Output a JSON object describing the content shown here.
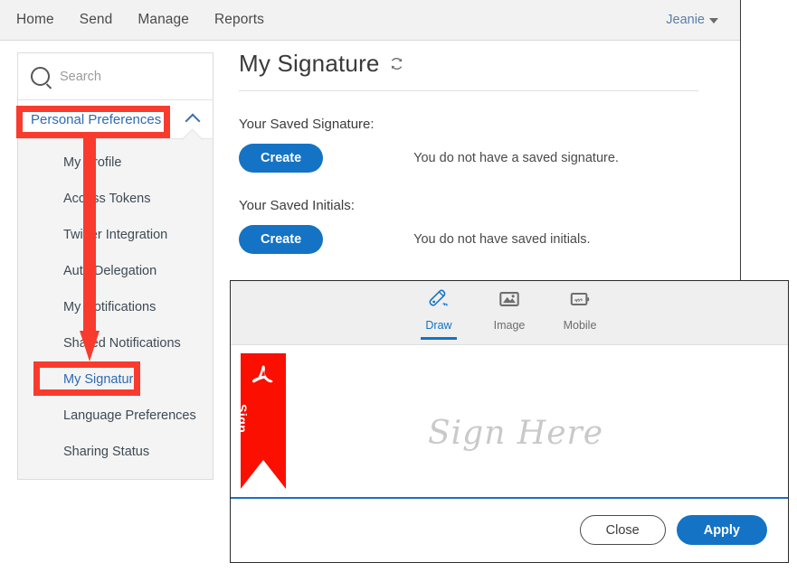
{
  "topnav": {
    "links": [
      {
        "label": "Home"
      },
      {
        "label": "Send"
      },
      {
        "label": "Manage"
      },
      {
        "label": "Reports"
      }
    ],
    "user": {
      "name": "Jeanie",
      "caret_icon": "chevron-down-icon"
    }
  },
  "sidebar": {
    "search": {
      "placeholder": "Search",
      "value": "",
      "icon": "search-icon"
    },
    "accordion": {
      "title": "Personal Preferences",
      "expanded": true,
      "chevron_icon": "chevron-up-icon"
    },
    "items": [
      {
        "label": "My Profile",
        "selected": false
      },
      {
        "label": "Access Tokens",
        "selected": false
      },
      {
        "label": "Twitter Integration",
        "selected": false
      },
      {
        "label": "Auto Delegation",
        "selected": false
      },
      {
        "label": "My Notifications",
        "selected": false
      },
      {
        "label": "Shared Notifications",
        "selected": false
      },
      {
        "label": "My Signature",
        "selected": true
      },
      {
        "label": "Language Preferences",
        "selected": false
      },
      {
        "label": "Sharing Status",
        "selected": false
      }
    ]
  },
  "main": {
    "title": "My Signature",
    "refresh_icon": "refresh-icon",
    "signature_section": {
      "label": "Your Saved Signature:",
      "create_label": "Create",
      "empty_note": "You do not have a saved signature."
    },
    "initials_section": {
      "label": "Your Saved Initials:",
      "create_label": "Create",
      "empty_note": "You do not have saved initials."
    }
  },
  "modal": {
    "tabs": [
      {
        "label": "Draw",
        "icon": "pen-draw-icon",
        "active": true
      },
      {
        "label": "Image",
        "icon": "image-icon",
        "active": false
      },
      {
        "label": "Mobile",
        "icon": "mobile-device-icon",
        "active": false
      }
    ],
    "canvas": {
      "pdf_tag_label": "Sign",
      "pdf_tag_icon": "adobe-acrobat-icon",
      "watermark": "Sign Here"
    },
    "footer": {
      "close_label": "Close",
      "apply_label": "Apply"
    }
  },
  "colors": {
    "accent_blue": "#1473c4",
    "link_blue": "#2e6ab1",
    "annotation_red": "#f93b2e",
    "pdf_red": "#fa0f00",
    "nav_bg": "#f2f2f2",
    "submenu_bg": "#f4f4f4",
    "modal_header_bg": "#efefef"
  }
}
